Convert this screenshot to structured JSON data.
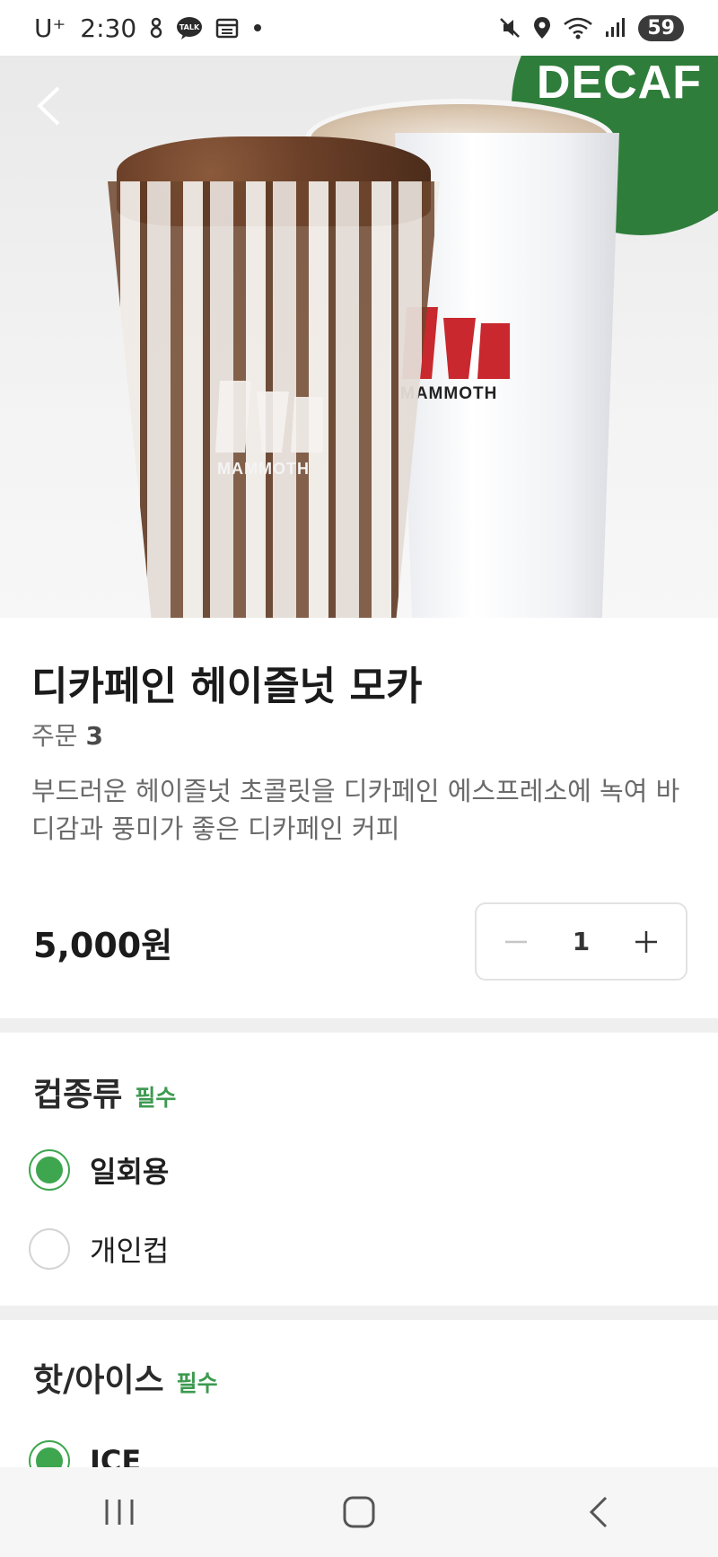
{
  "status_bar": {
    "carrier": "U⁺",
    "time": "2:30",
    "battery": "59",
    "icons": [
      "wireless-paging-icon",
      "kakaotalk-icon",
      "calendar-icon",
      "dot-icon",
      "mute-icon",
      "location-icon",
      "wifi-icon",
      "signal-icon"
    ]
  },
  "hero": {
    "badge_text": "DECAF",
    "cup_brand_hot": "MAMMOTH",
    "cup_brand_ice": "MAMMOTH",
    "badge_color": "#2f7d3b"
  },
  "product": {
    "title": "디카페인 헤이즐넛 모카",
    "order_label": "주문",
    "order_count": "3",
    "description": "부드러운 헤이즐넛 초콜릿을 디카페인 에스프레소에 녹여 바디감과 풍미가 좋은 디카페인 커피",
    "price": "5,000원",
    "quantity": "1"
  },
  "sections": {
    "cup_type": {
      "title": "컵종류",
      "required_label": "필수",
      "options": [
        {
          "label": "일회용",
          "selected": true
        },
        {
          "label": "개인컵",
          "selected": false
        }
      ]
    },
    "temperature": {
      "title": "핫/아이스",
      "required_label": "필수",
      "options": [
        {
          "label": "ICE",
          "selected": true
        }
      ]
    }
  },
  "colors": {
    "accent_green": "#3ea64f",
    "required_green": "#3d9a4f"
  },
  "navbar": {
    "icons": [
      "recent-apps-icon",
      "home-icon",
      "back-icon"
    ]
  }
}
